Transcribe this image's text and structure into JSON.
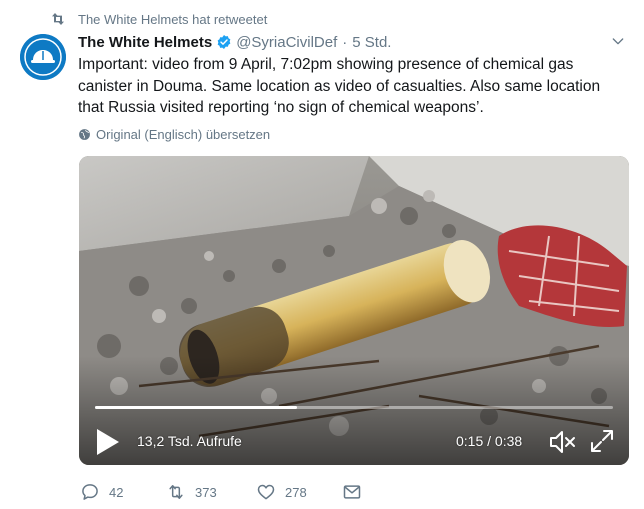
{
  "retweet_context": {
    "text": "The White Helmets hat retweetet"
  },
  "tweet": {
    "author_name": "The White Helmets",
    "handle": "@SyriaCivilDef",
    "separator": "·",
    "time": "5 Std.",
    "text": "Important: video from 9 April, 7:02pm showing presence of chemical gas canister in Douma. Same location as video of casualties. Also same location that Russia visited reporting ‘no sign of chemical weapons’.",
    "translate_label": "Original (Englisch) übersetzen"
  },
  "video": {
    "views": "13,2 Tsd. Aufrufe",
    "timecode": "0:15 / 0:38",
    "progress_fraction": 0.39
  },
  "actions": {
    "replies": "42",
    "retweets": "373",
    "likes": "278"
  },
  "colors": {
    "brand_blue": "#1da1f2",
    "muted": "#657786",
    "avatar_bg": "#0e7ac4"
  },
  "icons": [
    "retweet-icon",
    "verified-icon",
    "chevron-down-icon",
    "globe-icon",
    "play-icon",
    "mute-icon",
    "fullscreen-icon",
    "reply-icon",
    "like-icon",
    "direct-message-icon"
  ]
}
